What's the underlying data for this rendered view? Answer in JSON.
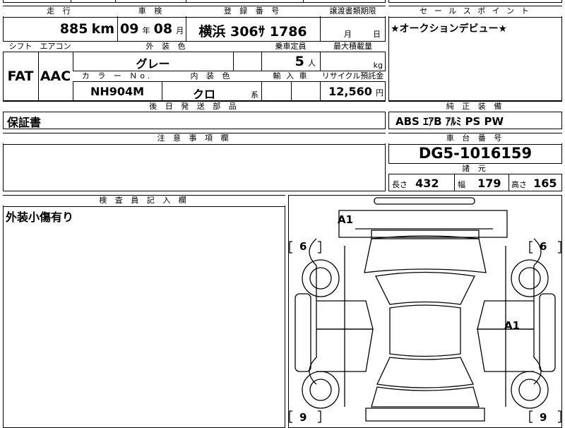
{
  "headers": {
    "mileage": "走 行",
    "inspection": "車 検",
    "registration": "登 録 番 号",
    "transfer": "譲渡書類期限",
    "sales_point": "セ ー ル ス ポ イ ン ト",
    "shift": "シフト",
    "aircon": "エアコン",
    "exterior": "外 装 色",
    "capacity": "乗車定員",
    "max_load": "最大積載量",
    "color_no": "カ ラ ー Ｎo.",
    "interior": "内 装 色",
    "import": "輸 入 車",
    "recycle": "リサイクル預託金",
    "shipping_parts": "後 日 発 送 部 品",
    "genuine_equipment": "純 正 装 備",
    "notes": "注 意 事 項 欄",
    "chassis_no": "車 台 番 号",
    "specs": "諸 元",
    "inspector": "検 査 員 記 入 欄"
  },
  "values": {
    "mileage": "885",
    "mileage_unit": "km",
    "inspection_year": "09",
    "year_unit": "年",
    "inspection_month": "08",
    "month_unit": "月",
    "registration": "横浜 306ｻ 1786",
    "transfer_month_unit": "月",
    "transfer_day_unit": "日",
    "sales_point": "★オークションデビュー★",
    "shift": "FAT",
    "aircon": "AAC",
    "exterior_color": "グレー",
    "capacity": "5",
    "capacity_unit": "人",
    "max_load_unit": "kg",
    "color_no": "NH904M",
    "interior_color": "クロ",
    "interior_suffix": "系",
    "recycle": "12,560",
    "recycle_unit": "円",
    "shipping_parts": "保証書",
    "genuine_equipment": "ABS ｴｱB ｱﾙﾐ PS PW",
    "chassis_no": "DG5-1016159",
    "length_label": "長さ",
    "length": "432",
    "width_label": "幅",
    "width": "179",
    "height_label": "高さ",
    "height": "165",
    "inspector_notes": "外装小傷有り"
  },
  "diagram": {
    "marks": [
      "A1",
      "A1"
    ],
    "tire_fl": "6",
    "tire_fr": "6",
    "tire_rl": "9",
    "tire_rr": "9"
  }
}
